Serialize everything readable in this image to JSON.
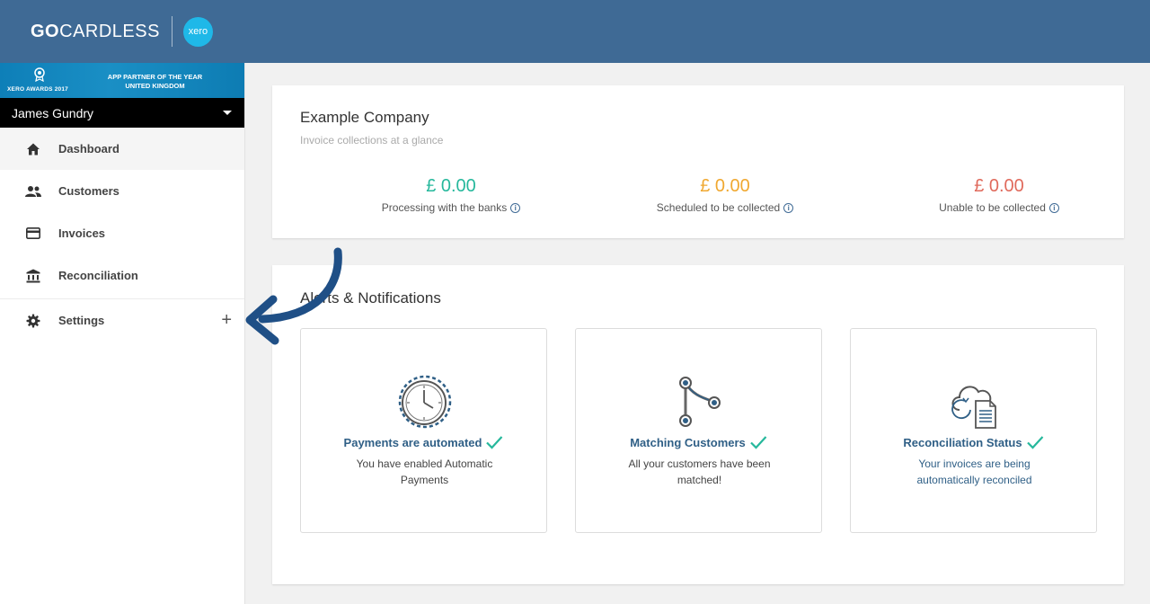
{
  "brand": {
    "go": "GO",
    "cardless": "CARDLESS",
    "xero": "xero"
  },
  "award": {
    "year": "XERO AWARDS 2017",
    "line1": "APP PARTNER OF THE YEAR",
    "line2": "UNITED KINGDOM"
  },
  "user": {
    "name": "James Gundry"
  },
  "nav": {
    "items": [
      {
        "label": "Dashboard",
        "icon": "home-icon"
      },
      {
        "label": "Customers",
        "icon": "people-icon"
      },
      {
        "label": "Invoices",
        "icon": "card-icon"
      },
      {
        "label": "Reconciliation",
        "icon": "bank-icon"
      },
      {
        "label": "Settings",
        "icon": "gear-icon"
      }
    ],
    "settings_expand": "+"
  },
  "summary": {
    "company": "Example Company",
    "subtitle": "Invoice collections at a glance",
    "stats": [
      {
        "amount": "£ 0.00",
        "label": "Processing with the banks",
        "color": "#26b89c"
      },
      {
        "amount": "£ 0.00",
        "label": "Scheduled to be collected",
        "color": "#f0a830"
      },
      {
        "amount": "£ 0.00",
        "label": "Unable to be collected",
        "color": "#e06a5c"
      }
    ]
  },
  "alerts": {
    "title": "Alerts & Notifications",
    "cards": [
      {
        "title": "Payments are automated",
        "desc": "You have enabled Automatic Payments",
        "icon": "clock-icon"
      },
      {
        "title": "Matching Customers",
        "desc": "All your customers have been matched!",
        "icon": "merge-icon"
      },
      {
        "title": "Reconciliation Status",
        "desc": "Your invoices are being automatically reconciled",
        "icon": "cloud-document-icon"
      }
    ]
  },
  "colors": {
    "header": "#3f6a95",
    "accent_check": "#26b89c",
    "arrow": "#1f4f86"
  }
}
